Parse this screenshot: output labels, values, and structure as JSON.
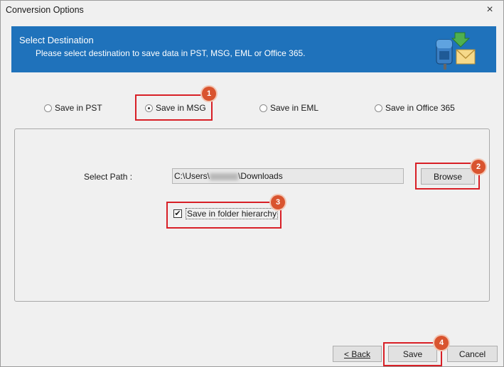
{
  "window": {
    "title": "Conversion Options",
    "close_symbol": "×"
  },
  "banner": {
    "title": "Select Destination",
    "subtitle": "Please select destination to save data in PST, MSG, EML or Office 365.",
    "icon": "mailbox-export-icon",
    "color": "#1f72bb"
  },
  "save_options": [
    {
      "label": "Save in PST",
      "checked": false
    },
    {
      "label": "Save in MSG",
      "checked": true
    },
    {
      "label": "Save in EML",
      "checked": false
    },
    {
      "label": "Save in Office 365",
      "checked": false
    }
  ],
  "path": {
    "label": "Select Path :",
    "value_prefix": "C:\\Users\\",
    "value_suffix": "\\Downloads",
    "browse_label": "Browse"
  },
  "hierarchy": {
    "label": "Save in folder hierarchy",
    "checked": true
  },
  "footer": {
    "back_label": "< Back",
    "save_label": "Save",
    "cancel_label": "Cancel"
  },
  "annotations": [
    "1",
    "2",
    "3",
    "4"
  ],
  "highlight_color": "#d81f26",
  "badge_color": "#d9542f"
}
